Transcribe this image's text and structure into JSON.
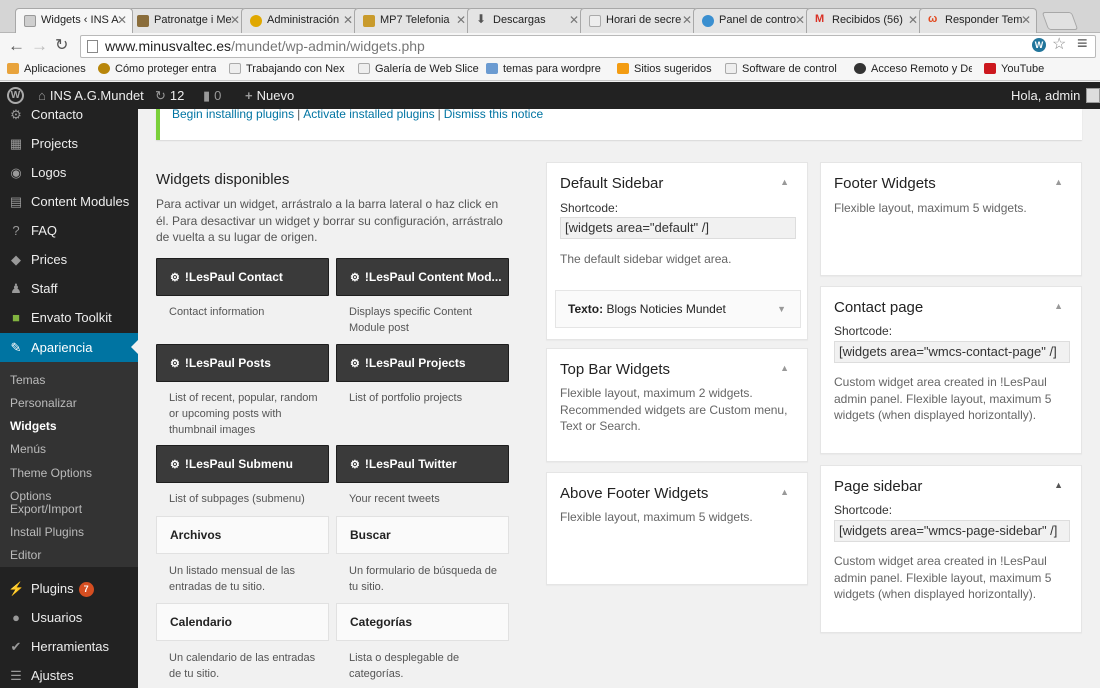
{
  "browser": {
    "tabs": [
      {
        "title": "Widgets ‹ INS A",
        "color": "#cfcfcf"
      },
      {
        "title": "Patronatge i Me",
        "color": "#8a6d3b"
      },
      {
        "title": "Administración",
        "color": "#e0a800"
      },
      {
        "title": "MP7 Telefonia",
        "color": "#c99b2c"
      },
      {
        "title": "Descargas",
        "color": "#777777"
      },
      {
        "title": "Horari de secre",
        "color": "#d8d8d8"
      },
      {
        "title": "Panel de contro",
        "color": "#3a8fd0"
      },
      {
        "title": "Recibidos (56)",
        "color": "#d93025"
      },
      {
        "title": "Responder Tem",
        "color": "#e24a20"
      }
    ],
    "address": {
      "domain": "www.minusvaltec.es",
      "path": "/mundet/wp-admin/widgets.php"
    },
    "bookmarks": [
      {
        "label": "Aplicaciones",
        "color": "#e8a33c"
      },
      {
        "label": "Cómo proteger entra",
        "color": "#b8860b"
      },
      {
        "label": "Trabajando con Nex",
        "color": "#eeeeee"
      },
      {
        "label": "Galería de Web Slice",
        "color": "#eeeeee"
      },
      {
        "label": "temas para wordpre",
        "color": "#6b9bd1"
      },
      {
        "label": "Sitios sugeridos",
        "color": "#f39c12"
      },
      {
        "label": "Software de control",
        "color": "#eeeeee"
      },
      {
        "label": "Acceso Remoto y De",
        "color": "#333333"
      },
      {
        "label": "YouTube",
        "color": "#cc181e"
      }
    ]
  },
  "adminbar": {
    "site": "INS A.G.Mundet",
    "updates": "12",
    "comments": "0",
    "new": "Nuevo",
    "greeting": "Hola, admin"
  },
  "sidebar": {
    "items_top": [
      {
        "label": "Contacto",
        "icon": "envelope-icon"
      },
      {
        "label": "Projects",
        "icon": "grid-icon"
      },
      {
        "label": "Logos",
        "icon": "eye-icon"
      },
      {
        "label": "Content Modules",
        "icon": "document-icon"
      },
      {
        "label": "FAQ",
        "icon": "question-icon"
      },
      {
        "label": "Prices",
        "icon": "tag-icon"
      },
      {
        "label": "Staff",
        "icon": "users-icon"
      },
      {
        "label": "Envato Toolkit",
        "icon": "envato-icon"
      },
      {
        "label": "Apariencia",
        "icon": "brush-icon"
      }
    ],
    "submenu": [
      {
        "label": "Temas"
      },
      {
        "label": "Personalizar"
      },
      {
        "label": "Widgets"
      },
      {
        "label": "Menús"
      },
      {
        "label": "Theme Options"
      },
      {
        "label": "Options\nExport/Import"
      },
      {
        "label": "Install Plugins"
      },
      {
        "label": "Editor"
      }
    ],
    "items_bottom": [
      {
        "label": "Plugins",
        "icon": "plug-icon",
        "badge": "7"
      },
      {
        "label": "Usuarios",
        "icon": "user-icon"
      },
      {
        "label": "Herramientas",
        "icon": "wrench-icon"
      },
      {
        "label": "Ajustes",
        "icon": "settings-icon"
      }
    ]
  },
  "notice": {
    "links": [
      "Begin installing plugins",
      "Activate installed plugins",
      "Dismiss this notice"
    ],
    "separator": "|"
  },
  "available": {
    "title": "Widgets disponibles",
    "description": "Para activar un widget, arrástralo a la barra lateral o haz click en él. Para desactivar un widget y borrar su configuración, arrástralo de vuelta a su lugar de origen.",
    "widgets": [
      {
        "name": "!LesPaul Contact",
        "desc": "Contact information",
        "dark": true
      },
      {
        "name": "!LesPaul Content Mod...",
        "desc": "Displays specific Content Module post",
        "dark": true
      },
      {
        "name": "!LesPaul Posts",
        "desc": "List of recent, popular, random or upcoming posts with thumbnail images",
        "dark": true
      },
      {
        "name": "!LesPaul Projects",
        "desc": "List of portfolio projects",
        "dark": true
      },
      {
        "name": "!LesPaul Submenu",
        "desc": "List of subpages (submenu)",
        "dark": true
      },
      {
        "name": "!LesPaul Twitter",
        "desc": "Your recent tweets",
        "dark": true
      },
      {
        "name": "Archivos",
        "desc": "Un listado mensual de las entradas de tu sitio.",
        "dark": false
      },
      {
        "name": "Buscar",
        "desc": "Un formulario de búsqueda de tu sitio.",
        "dark": false
      },
      {
        "name": "Calendario",
        "desc": "Un calendario de las entradas de tu sitio.",
        "dark": false
      },
      {
        "name": "Categorías",
        "desc": "Lista o desplegable de categorías.",
        "dark": false
      }
    ]
  },
  "areas": {
    "default_sidebar": {
      "title": "Default Sidebar",
      "shortcode_label": "Shortcode:",
      "shortcode": "[widgets area=\"default\" /]",
      "description": "The default sidebar widget area.",
      "widget_type": "Texto:",
      "widget_title": "Blogs Noticies Mundet"
    },
    "top_bar": {
      "title": "Top Bar Widgets",
      "description": "Flexible layout, maximum 2 widgets. Recommended widgets are Custom menu, Text or Search."
    },
    "above_footer": {
      "title": "Above Footer Widgets",
      "description": "Flexible layout, maximum 5 widgets."
    },
    "footer": {
      "title": "Footer Widgets",
      "description": "Flexible layout, maximum 5 widgets."
    },
    "contact_page": {
      "title": "Contact page",
      "shortcode_label": "Shortcode:",
      "shortcode": "[widgets area=\"wmcs-contact-page\" /]",
      "description": "Custom widget area created in !LesPaul admin panel. Flexible layout, maximum 5 widgets (when displayed horizontally)."
    },
    "page_sidebar": {
      "title": "Page sidebar",
      "shortcode_label": "Shortcode:",
      "shortcode": "[widgets area=\"wmcs-page-sidebar\" /]",
      "description": "Custom widget area created in !LesPaul admin panel. Flexible layout, maximum 5 widgets (when displayed horizontally)."
    }
  },
  "colors": {
    "admin_bar": "#222222",
    "menu_current": "#0074a2",
    "notice_border": "#7ad03a",
    "link": "#0074a2",
    "badge": "#d54e21"
  }
}
